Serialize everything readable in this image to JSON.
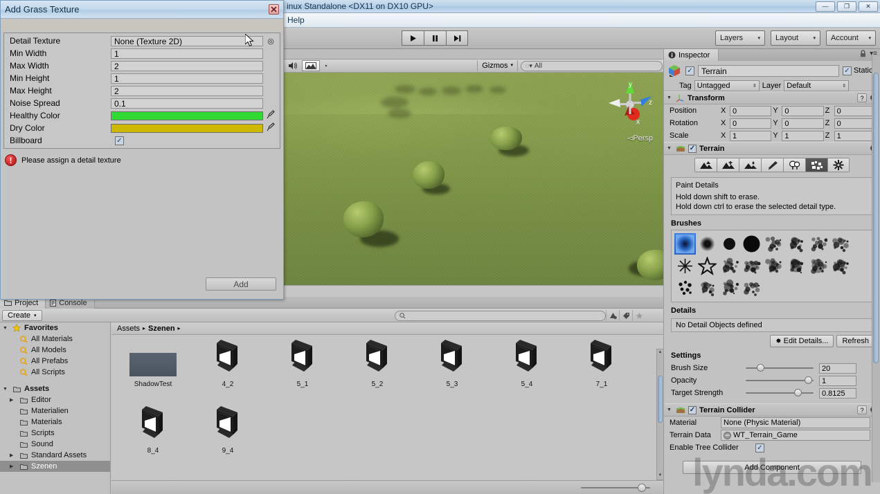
{
  "window": {
    "title": "inux Standalone <DX11 on DX10 GPU>",
    "minimize": "—",
    "restore": "❐",
    "close": "✕"
  },
  "menubar": {
    "items": [
      "Help"
    ]
  },
  "toolbar": {
    "play": "▶",
    "pause": "❙❙",
    "step": "▶❙",
    "layers": "Layers",
    "layout": "Layout",
    "account": "Account",
    "caret": "▾"
  },
  "scene": {
    "audio_icon": "🔊",
    "gizmos_label": "Gizmos",
    "search_value": "All",
    "search_icon": "Q",
    "gizmo_axes": {
      "x": "x",
      "y": "y",
      "z": "z"
    },
    "perspective_label": "Persp",
    "perspective_arrow": "◅"
  },
  "inspector": {
    "tab_label": "Inspector",
    "tab_icon": "i",
    "lock_icon": "🔒",
    "menu_icon": "≡",
    "object": {
      "enabled": true,
      "name": "Terrain",
      "static_label": "Static",
      "static_checked": true,
      "tag_label": "Tag",
      "tag_value": "Untagged",
      "layer_label": "Layer",
      "layer_value": "Default"
    },
    "transform": {
      "title": "Transform",
      "rows": [
        {
          "label": "Position",
          "x": "0",
          "y": "0",
          "z": "0"
        },
        {
          "label": "Rotation",
          "x": "0",
          "y": "0",
          "z": "0"
        },
        {
          "label": "Scale",
          "x": "1",
          "y": "1",
          "z": "1"
        }
      ],
      "axis_labels": [
        "X",
        "Y",
        "Z"
      ]
    },
    "terrain": {
      "title": "Terrain",
      "enabled": true,
      "tools": [
        "raise-lower-terrain-tool",
        "paint-height-tool",
        "smooth-height-tool",
        "paint-texture-tool",
        "place-trees-tool",
        "paint-details-tool",
        "terrain-settings-tool"
      ],
      "active_tool_index": 5,
      "help_title": "Paint Details",
      "help_line1": "Hold down shift to erase.",
      "help_line2": "Hold down ctrl to erase the selected detail type.",
      "brushes_title": "Brushes",
      "brush_count": 20,
      "selected_brush": 0,
      "details_title": "Details",
      "details_empty": "No Detail Objects defined",
      "edit_details_label": "Edit Details...",
      "refresh_label": "Refresh",
      "settings_title": "Settings",
      "settings": [
        {
          "label": "Brush Size",
          "value": "20",
          "pct": 18
        },
        {
          "label": "Opacity",
          "value": "1",
          "pct": 98
        },
        {
          "label": "Target Strength",
          "value": "0.8125",
          "pct": 81
        }
      ]
    },
    "terrain_collider": {
      "title": "Terrain Collider",
      "enabled": true,
      "material_label": "Material",
      "material_value": "None (Physic Material)",
      "terrain_data_label": "Terrain Data",
      "terrain_data_value": "WT_Terrain_Game",
      "tree_collider_label": "Enable Tree Collider",
      "tree_collider_checked": true
    },
    "add_component_label": "Add Component"
  },
  "project": {
    "tabs": [
      {
        "label": "Project",
        "icon": "folder-icon",
        "active": true
      },
      {
        "label": "Console",
        "icon": "console-icon",
        "active": false
      }
    ],
    "create_label": "Create",
    "create_caret": "▾",
    "search_placeholder": "",
    "search_icon": "Q",
    "filter_buttons": [
      "asset-type-filter-icon",
      "label-filter-icon",
      "favorite-filter-icon"
    ],
    "tree": [
      {
        "label": "Favorites",
        "icon": "star-icon",
        "bold": true,
        "arrow": "▼",
        "indent": 0,
        "selected": false
      },
      {
        "label": "All Materials",
        "icon": "search-icon",
        "bold": false,
        "arrow": "",
        "indent": 1,
        "selected": false
      },
      {
        "label": "All Models",
        "icon": "search-icon",
        "bold": false,
        "arrow": "",
        "indent": 1,
        "selected": false
      },
      {
        "label": "All Prefabs",
        "icon": "search-icon",
        "bold": false,
        "arrow": "",
        "indent": 1,
        "selected": false
      },
      {
        "label": "All Scripts",
        "icon": "search-icon",
        "bold": false,
        "arrow": "",
        "indent": 1,
        "selected": false
      },
      {
        "label": "",
        "icon": "",
        "bold": false,
        "arrow": "",
        "indent": 0,
        "selected": false
      },
      {
        "label": "Assets",
        "icon": "folder-icon",
        "bold": true,
        "arrow": "▼",
        "indent": 0,
        "selected": false
      },
      {
        "label": "Editor",
        "icon": "folder-icon",
        "bold": false,
        "arrow": "▶",
        "indent": 1,
        "selected": false
      },
      {
        "label": "Materialien",
        "icon": "folder-icon",
        "bold": false,
        "arrow": "",
        "indent": 1,
        "selected": false
      },
      {
        "label": "Materials",
        "icon": "folder-icon",
        "bold": false,
        "arrow": "",
        "indent": 1,
        "selected": false
      },
      {
        "label": "Scripts",
        "icon": "folder-icon",
        "bold": false,
        "arrow": "",
        "indent": 1,
        "selected": false
      },
      {
        "label": "Sound",
        "icon": "folder-icon",
        "bold": false,
        "arrow": "",
        "indent": 1,
        "selected": false
      },
      {
        "label": "Standard Assets",
        "icon": "folder-icon",
        "bold": false,
        "arrow": "▶",
        "indent": 1,
        "selected": false
      },
      {
        "label": "Szenen",
        "icon": "folder-icon",
        "bold": false,
        "arrow": "▶",
        "indent": 1,
        "selected": true
      }
    ],
    "breadcrumb": [
      "Assets",
      "Szenen"
    ],
    "breadcrumb_sep": "▸",
    "assets": [
      {
        "label": "ShadowTest",
        "icon": "scene-thumbnail",
        "col": 0,
        "row": 0
      },
      {
        "label": "4_2",
        "icon": "unity-scene-icon",
        "col": 1,
        "row": 0
      },
      {
        "label": "5_1",
        "icon": "unity-scene-icon",
        "col": 2,
        "row": 0
      },
      {
        "label": "5_2",
        "icon": "unity-scene-icon",
        "col": 3,
        "row": 0
      },
      {
        "label": "5_3",
        "icon": "unity-scene-icon",
        "col": 4,
        "row": 0
      },
      {
        "label": "5_4",
        "icon": "unity-scene-icon",
        "col": 5,
        "row": 0
      },
      {
        "label": "7_1",
        "icon": "unity-scene-icon",
        "col": 6,
        "row": 0
      },
      {
        "label": "8_4",
        "icon": "unity-scene-icon",
        "col": 0,
        "row": 1
      },
      {
        "label": "9_4",
        "icon": "unity-scene-icon",
        "col": 1,
        "row": 1
      }
    ],
    "scroll_up": "▲",
    "scroll_down": "▼"
  },
  "grass_dialog": {
    "title": "Add Grass Texture",
    "close_icon": "✕",
    "fields": [
      {
        "label": "Detail Texture",
        "type": "object",
        "value": "None (Texture 2D)",
        "picker": "◎"
      },
      {
        "label": "Min Width",
        "type": "text",
        "value": "1"
      },
      {
        "label": "Max Width",
        "type": "text",
        "value": "2"
      },
      {
        "label": "Min Height",
        "type": "text",
        "value": "1"
      },
      {
        "label": "Max Height",
        "type": "text",
        "value": "2"
      },
      {
        "label": "Noise Spread",
        "type": "text",
        "value": "0.1"
      },
      {
        "label": "Healthy Color",
        "type": "color",
        "value": "#32d932"
      },
      {
        "label": "Dry Color",
        "type": "color",
        "value": "#cfb800"
      },
      {
        "label": "Billboard",
        "type": "checkbox",
        "value": "✓"
      }
    ],
    "warning": "Please assign a detail texture",
    "warning_icon": "!",
    "add_label": "Add"
  },
  "watermark": "lynda.com",
  "colors": {
    "accent_blue": "#3d7fe0",
    "healthy_green": "#32d932",
    "dry_yellow": "#cfb800",
    "terrain_green": "#7f9747",
    "panel_gray": "#c2c2c2"
  }
}
